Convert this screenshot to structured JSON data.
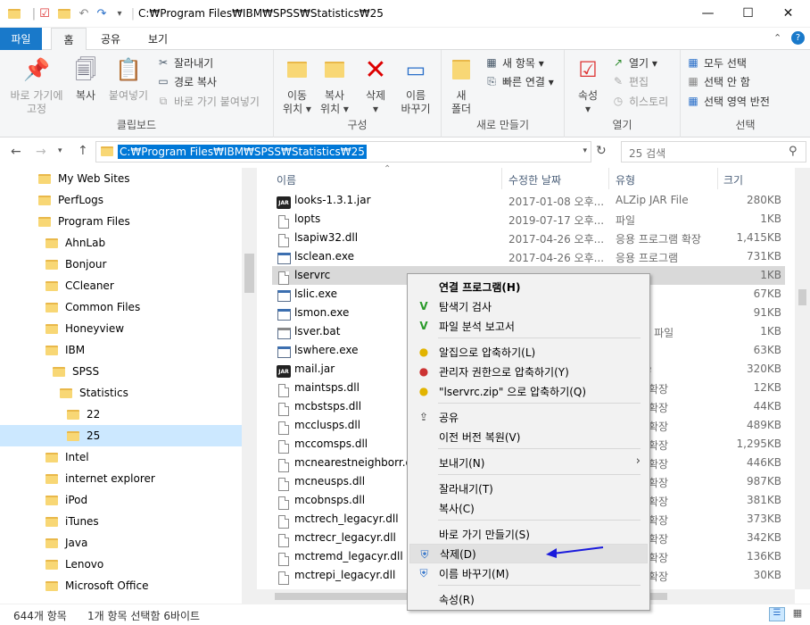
{
  "titlebar": {
    "path": "C:₩Program Files₩IBM₩SPSS₩Statistics₩25",
    "minimize": "—",
    "maximize": "☐",
    "close": "✕"
  },
  "tabs": {
    "file": "파일",
    "home": "홈",
    "share": "공유",
    "view": "보기"
  },
  "ribbon": {
    "clipboard": {
      "label": "클립보드",
      "pin": "바로 가기에\n고정",
      "copy": "복사",
      "paste": "붙여넣기",
      "cut": "잘라내기",
      "copy_path": "경로 복사",
      "paste_shortcut": "바로 가기 붙여넣기"
    },
    "organize": {
      "label": "구성",
      "move_to": "이동\n위치 ▾",
      "copy_to": "복사\n위치 ▾",
      "delete": "삭제\n▾",
      "rename": "이름\n바꾸기"
    },
    "new": {
      "label": "새로 만들기",
      "new_folder": "새\n폴더",
      "new_item": "새 항목 ▾",
      "easy_access": "빠른 연결 ▾"
    },
    "open": {
      "label": "열기",
      "properties": "속성\n▾",
      "open": "열기 ▾",
      "edit": "편집",
      "history": "히스토리"
    },
    "select": {
      "label": "선택",
      "select_all": "모두 선택",
      "select_none": "선택 안 함",
      "invert": "선택 영역 반전"
    }
  },
  "address": {
    "path": "C:₩Program Files₩IBM₩SPSS₩Statistics₩25",
    "search_placeholder": "25 검색"
  },
  "tree": [
    {
      "label": "My Web Sites"
    },
    {
      "label": "PerfLogs"
    },
    {
      "label": "Program Files"
    },
    {
      "label": "AhnLab"
    },
    {
      "label": "Bonjour"
    },
    {
      "label": "CCleaner"
    },
    {
      "label": "Common Files"
    },
    {
      "label": "Honeyview"
    },
    {
      "label": "IBM"
    },
    {
      "label": "SPSS"
    },
    {
      "label": "Statistics"
    },
    {
      "label": "22"
    },
    {
      "label": "25"
    },
    {
      "label": "Intel"
    },
    {
      "label": "internet explorer"
    },
    {
      "label": "iPod"
    },
    {
      "label": "iTunes"
    },
    {
      "label": "Java"
    },
    {
      "label": "Lenovo"
    },
    {
      "label": "Microsoft Office"
    }
  ],
  "columns": {
    "name": "이름",
    "date": "수정한 날짜",
    "type": "유형",
    "size": "크기"
  },
  "files": [
    {
      "name": "looks-1.3.1.jar",
      "date": "2017-01-08 오후...",
      "type": "ALZip JAR File",
      "size": "280KB"
    },
    {
      "name": "lopts",
      "date": "2019-07-17 오후...",
      "type": "파일",
      "size": "1KB"
    },
    {
      "name": "lsapiw32.dll",
      "date": "2017-04-26 오후...",
      "type": "응용 프로그램 확장",
      "size": "1,415KB"
    },
    {
      "name": "lsclean.exe",
      "date": "2017-04-26 오후...",
      "type": "응용 프로그램",
      "size": "731KB"
    },
    {
      "name": "lservrc",
      "date": "",
      "type": "",
      "size": "1KB"
    },
    {
      "name": "lslic.exe",
      "date": "",
      "type": "로그램",
      "size": "67KB"
    },
    {
      "name": "lsmon.exe",
      "date": "",
      "type": "로그램",
      "size": "91KB"
    },
    {
      "name": "lsver.bat",
      "date": "",
      "type": "vs 배치 파일",
      "size": "1KB"
    },
    {
      "name": "lswhere.exe",
      "date": "",
      "type": "로그램",
      "size": "63KB"
    },
    {
      "name": "mail.jar",
      "date": "",
      "type": "AR File",
      "size": "320KB"
    },
    {
      "name": "maintsps.dll",
      "date": "",
      "type": "로그램 확장",
      "size": "12KB"
    },
    {
      "name": "mcbstsps.dll",
      "date": "",
      "type": "로그램 확장",
      "size": "44KB"
    },
    {
      "name": "mcclusps.dll",
      "date": "",
      "type": "로그램 확장",
      "size": "489KB"
    },
    {
      "name": "mccomsps.dll",
      "date": "",
      "type": "로그램 확장",
      "size": "1,295KB"
    },
    {
      "name": "mcnearestneighborr.dll",
      "date": "",
      "type": "로그램 확장",
      "size": "446KB"
    },
    {
      "name": "mcneusps.dll",
      "date": "",
      "type": "로그램 확장",
      "size": "987KB"
    },
    {
      "name": "mcobnsps.dll",
      "date": "",
      "type": "로그램 확장",
      "size": "381KB"
    },
    {
      "name": "mctrech_legacyr.dll",
      "date": "",
      "type": "로그램 확장",
      "size": "373KB"
    },
    {
      "name": "mctrecr_legacyr.dll",
      "date": "",
      "type": "로그램 확장",
      "size": "342KB"
    },
    {
      "name": "mctremd_legacyr.dll",
      "date": "",
      "type": "로그램 확장",
      "size": "136KB"
    },
    {
      "name": "mctrepi_legacyr.dll",
      "date": "",
      "type": "로그램 확장",
      "size": "30KB"
    }
  ],
  "context_menu": {
    "open_with": "연결 프로그램(H)",
    "scan": "탐색기 검사",
    "analysis": "파일 분석 보고서",
    "alzip": "알집으로 압축하기(L)",
    "alzip_admin": "관리자 권한으로 압축하기(Y)",
    "alzip_named": "\"lservrc.zip\" 으로 압축하기(Q)",
    "share": "공유",
    "restore": "이전 버전 복원(V)",
    "send_to": "보내기(N)",
    "cut": "잘라내기(T)",
    "copy": "복사(C)",
    "create_shortcut": "바로 가기 만들기(S)",
    "delete": "삭제(D)",
    "rename": "이름 바꾸기(M)",
    "properties": "속성(R)"
  },
  "status": {
    "count": "644개 항목",
    "selected": "1개 항목 선택함 6바이트"
  },
  "colors": {
    "accent": "#1979ca",
    "selection": "#cce8ff",
    "arrow": "#1a1adc"
  }
}
